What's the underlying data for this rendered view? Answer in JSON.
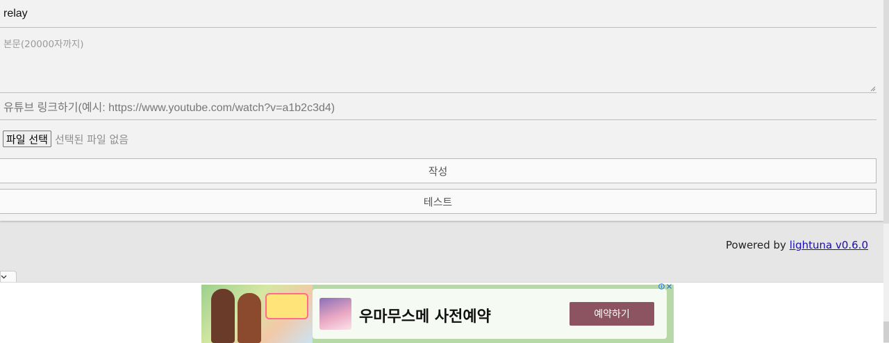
{
  "form": {
    "title_value": "relay",
    "body_placeholder": "본문(20000자까지)",
    "youtube_placeholder": "유튜브 링크하기(예시: https://www.youtube.com/watch?v=a1b2c3d4)",
    "file_button_label": "파일 선택",
    "file_status": "선택된 파일 없음",
    "submit_label": "작성",
    "test_label": "테스트"
  },
  "footer": {
    "powered_text": "Powered by",
    "link_text": "lightuna v0.6.0"
  },
  "ad": {
    "headline": "우마무스메 사전예약",
    "cta_label": "예약하기",
    "cta_color": "#8c5360"
  },
  "icons": {
    "collapse": "chevron-down-icon",
    "ad_choices": "ad-choices-icon",
    "ad_close": "close-icon"
  }
}
